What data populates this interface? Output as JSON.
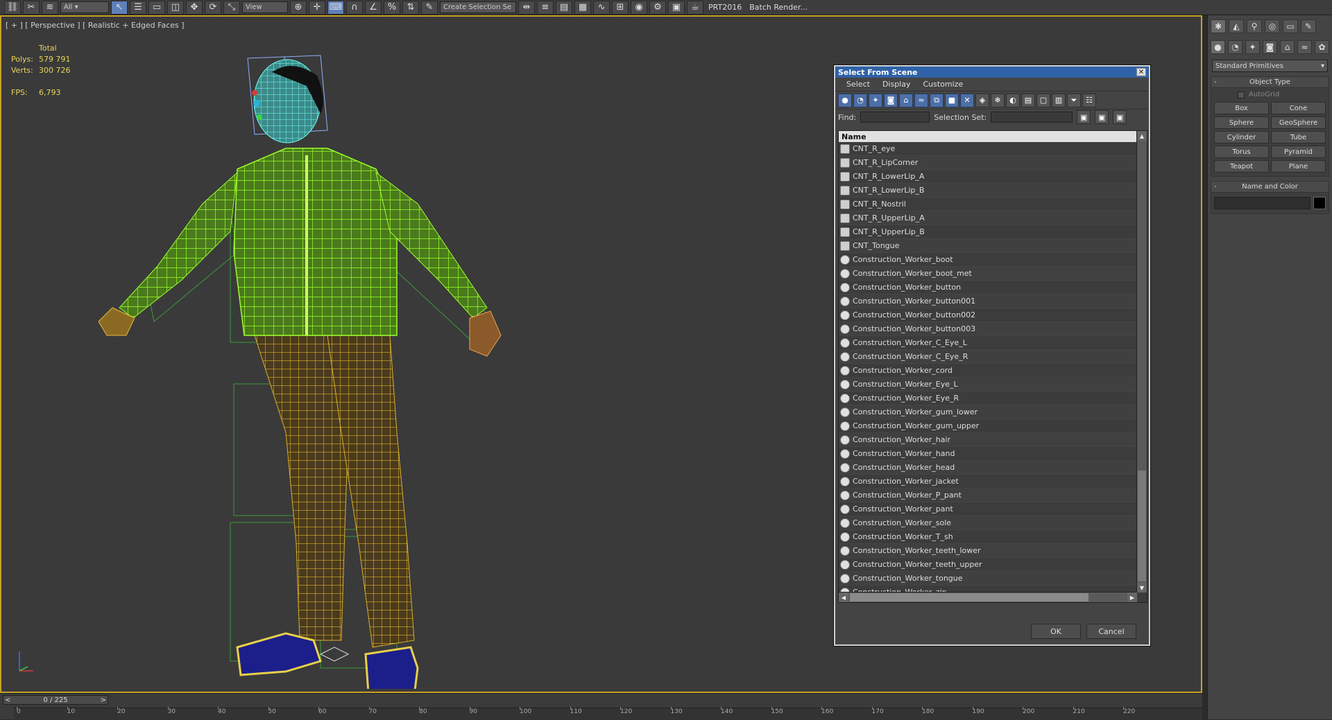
{
  "toolbar": {
    "view_combo": "View",
    "selection_set": "Create Selection Se",
    "prt_label": "PRT2016",
    "batch_label": "Batch Render..."
  },
  "viewport": {
    "label": "[ + ] [ Perspective ] [ Realistic + Edged Faces ]",
    "stats_header": "Total",
    "polys_label": "Polys:",
    "polys_value": "579 791",
    "verts_label": "Verts:",
    "verts_value": "300 726",
    "fps_label": "FPS:",
    "fps_value": "6,793"
  },
  "command_panel": {
    "category": "Standard Primitives",
    "object_type_title": "Object Type",
    "autogrid": "AutoGrid",
    "buttons": [
      "Box",
      "Cone",
      "Sphere",
      "GeoSphere",
      "Cylinder",
      "Tube",
      "Torus",
      "Pyramid",
      "Teapot",
      "Plane"
    ],
    "name_color_title": "Name and Color",
    "color": "#000000"
  },
  "timeline": {
    "frame": "0 / 225",
    "ticks": [
      "0",
      "10",
      "20",
      "30",
      "40",
      "50",
      "60",
      "70",
      "80",
      "90",
      "100",
      "110",
      "120",
      "130",
      "140",
      "150",
      "160",
      "170",
      "180",
      "190",
      "200",
      "210",
      "220"
    ]
  },
  "dialog": {
    "title": "Select From Scene",
    "menu": [
      "Select",
      "Display",
      "Customize"
    ],
    "find_label": "Find:",
    "selection_set_label": "Selection Set:",
    "column_name": "Name",
    "items": [
      {
        "name": "CNT_R_eye",
        "kind": "ctrl"
      },
      {
        "name": "CNT_R_LipCorner",
        "kind": "ctrl"
      },
      {
        "name": "CNT_R_LowerLip_A",
        "kind": "ctrl"
      },
      {
        "name": "CNT_R_LowerLip_B",
        "kind": "ctrl"
      },
      {
        "name": "CNT_R_Nostril",
        "kind": "ctrl"
      },
      {
        "name": "CNT_R_UpperLip_A",
        "kind": "ctrl"
      },
      {
        "name": "CNT_R_UpperLip_B",
        "kind": "ctrl"
      },
      {
        "name": "CNT_Tongue",
        "kind": "ctrl"
      },
      {
        "name": "Construction_Worker_boot",
        "kind": "geo"
      },
      {
        "name": "Construction_Worker_boot_met",
        "kind": "geo"
      },
      {
        "name": "Construction_Worker_button",
        "kind": "geo"
      },
      {
        "name": "Construction_Worker_button001",
        "kind": "geo"
      },
      {
        "name": "Construction_Worker_button002",
        "kind": "geo"
      },
      {
        "name": "Construction_Worker_button003",
        "kind": "geo"
      },
      {
        "name": "Construction_Worker_C_Eye_L",
        "kind": "geo"
      },
      {
        "name": "Construction_Worker_C_Eye_R",
        "kind": "geo"
      },
      {
        "name": "Construction_Worker_cord",
        "kind": "geo"
      },
      {
        "name": "Construction_Worker_Eye_L",
        "kind": "geo"
      },
      {
        "name": "Construction_Worker_Eye_R",
        "kind": "geo"
      },
      {
        "name": "Construction_Worker_gum_lower",
        "kind": "geo"
      },
      {
        "name": "Construction_Worker_gum_upper",
        "kind": "geo"
      },
      {
        "name": "Construction_Worker_hair",
        "kind": "geo"
      },
      {
        "name": "Construction_Worker_hand",
        "kind": "geo"
      },
      {
        "name": "Construction_Worker_head",
        "kind": "geo"
      },
      {
        "name": "Construction_Worker_jacket",
        "kind": "geo"
      },
      {
        "name": "Construction_Worker_P_pant",
        "kind": "geo"
      },
      {
        "name": "Construction_Worker_pant",
        "kind": "geo"
      },
      {
        "name": "Construction_Worker_sole",
        "kind": "geo"
      },
      {
        "name": "Construction_Worker_T_sh",
        "kind": "geo"
      },
      {
        "name": "Construction_Worker_teeth_lower",
        "kind": "geo"
      },
      {
        "name": "Construction_Worker_teeth_upper",
        "kind": "geo"
      },
      {
        "name": "Construction_Worker_tongue",
        "kind": "geo"
      },
      {
        "name": "Construction_Worker_zip",
        "kind": "geo"
      }
    ],
    "ok": "OK",
    "cancel": "Cancel"
  }
}
